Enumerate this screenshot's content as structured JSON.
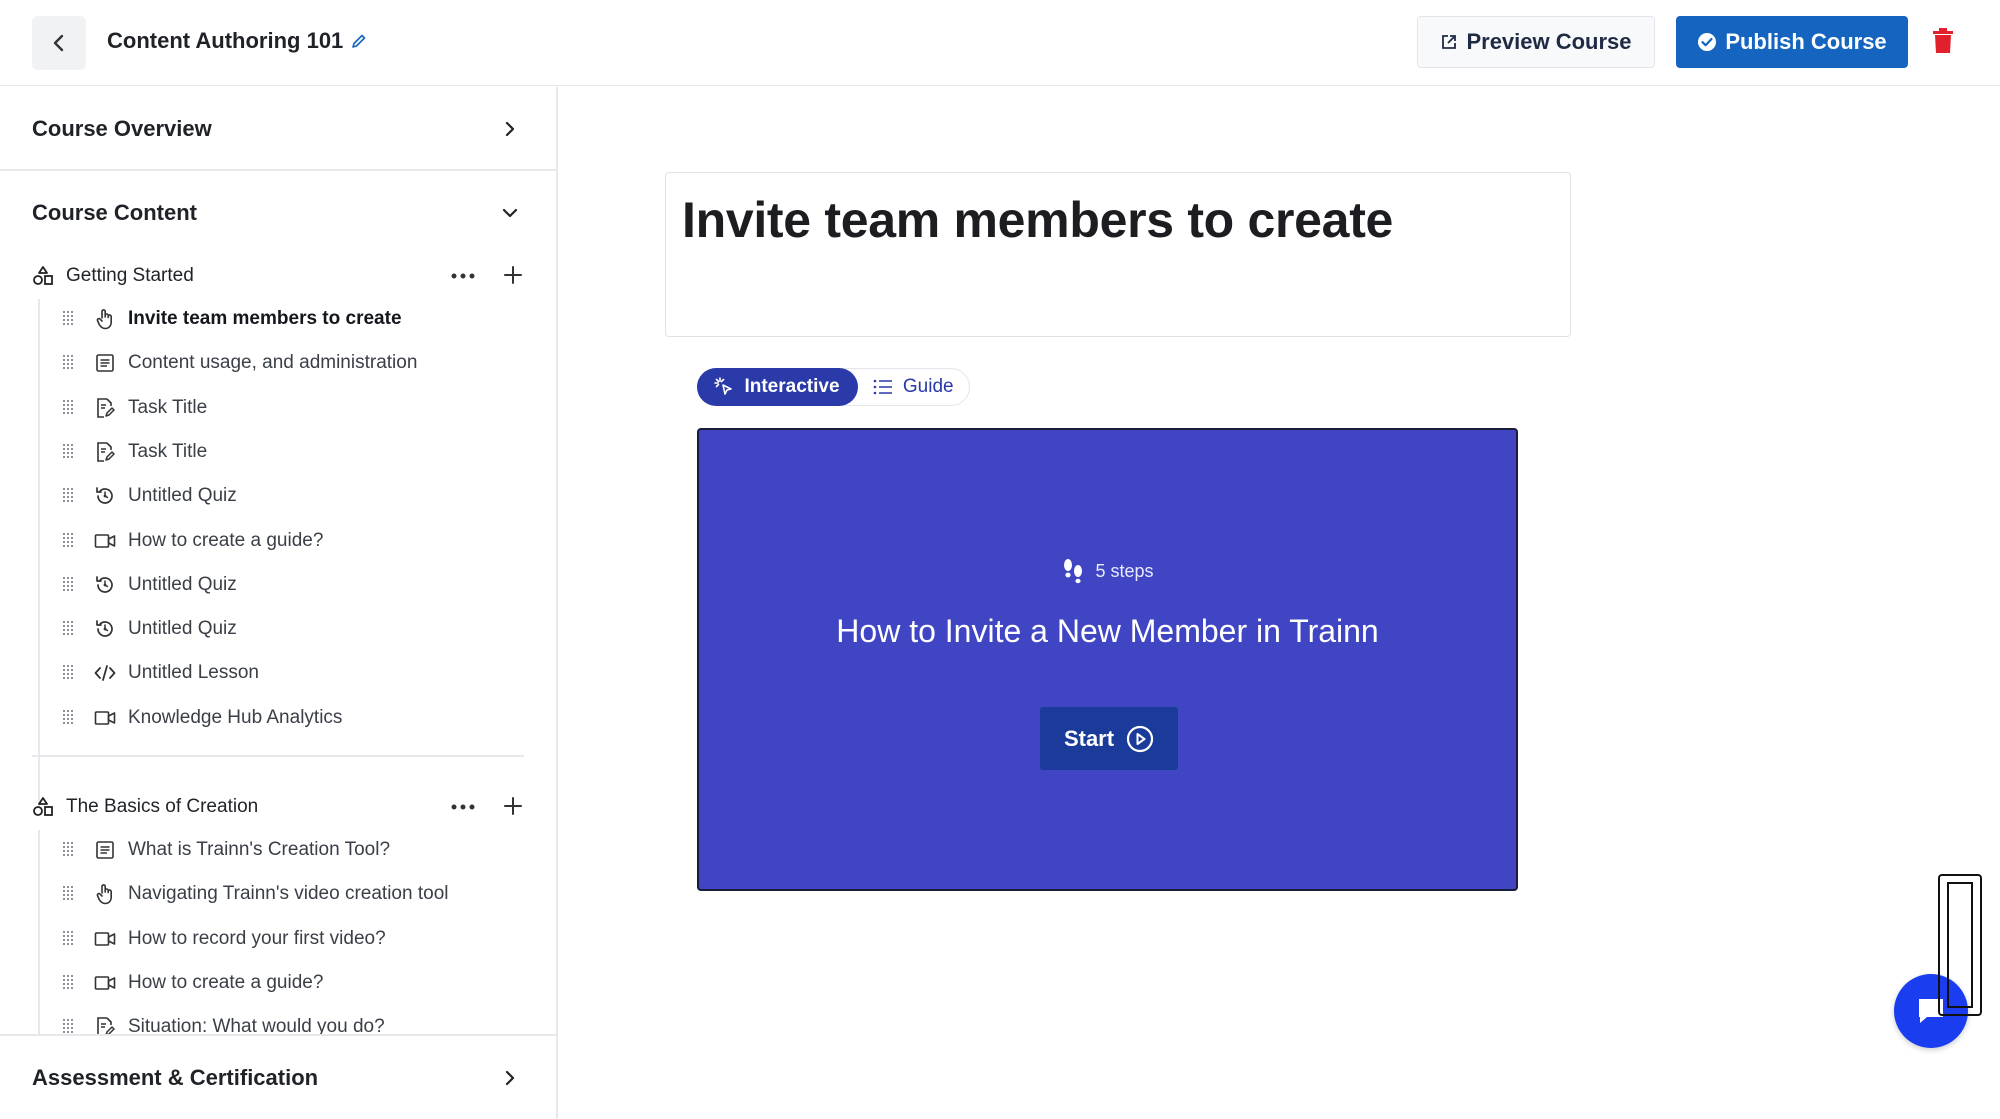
{
  "header": {
    "course_title": "Content Authoring 101",
    "preview_label": "Preview Course",
    "publish_label": "Publish Course"
  },
  "sidebar": {
    "overview_label": "Course Overview",
    "content_label": "Course Content",
    "assessment_label": "Assessment & Certification",
    "modules": [
      {
        "title": "Getting Started",
        "lessons": [
          {
            "label": "Invite team members to create",
            "icon": "pointer-icon"
          },
          {
            "label": "Content usage, and administration",
            "icon": "document-icon"
          },
          {
            "label": "Task Title",
            "icon": "task-icon"
          },
          {
            "label": "Task Title",
            "icon": "task-icon"
          },
          {
            "label": "Untitled Quiz",
            "icon": "quiz-icon"
          },
          {
            "label": "How to create a guide?",
            "icon": "video-icon"
          },
          {
            "label": "Untitled Quiz",
            "icon": "quiz-icon"
          },
          {
            "label": "Untitled Quiz",
            "icon": "quiz-icon"
          },
          {
            "label": "Untitled Lesson",
            "icon": "code-icon"
          },
          {
            "label": "Knowledge Hub Analytics",
            "icon": "video-icon"
          }
        ]
      },
      {
        "title": "The Basics of Creation",
        "lessons": [
          {
            "label": "What is Trainn's Creation Tool?",
            "icon": "document-icon"
          },
          {
            "label": "Navigating Trainn's video creation tool",
            "icon": "pointer-icon"
          },
          {
            "label": "How to record your first video?",
            "icon": "video-icon"
          },
          {
            "label": "How to create a guide?",
            "icon": "video-icon"
          },
          {
            "label": "Situation: What would you do?",
            "icon": "task-icon"
          }
        ]
      }
    ]
  },
  "main": {
    "lesson_title": "Invite team members to create",
    "toggle_interactive": "Interactive",
    "toggle_guide": "Guide",
    "player": {
      "steps": "5 steps",
      "title": "How to Invite a New Member in Trainn",
      "start_label": "Start"
    }
  },
  "colors": {
    "primary": "#1565c0",
    "player_bg": "#4045c4",
    "toggle_active": "#2a3aa8",
    "danger": "#e0202a",
    "chat": "#1a3df0"
  }
}
